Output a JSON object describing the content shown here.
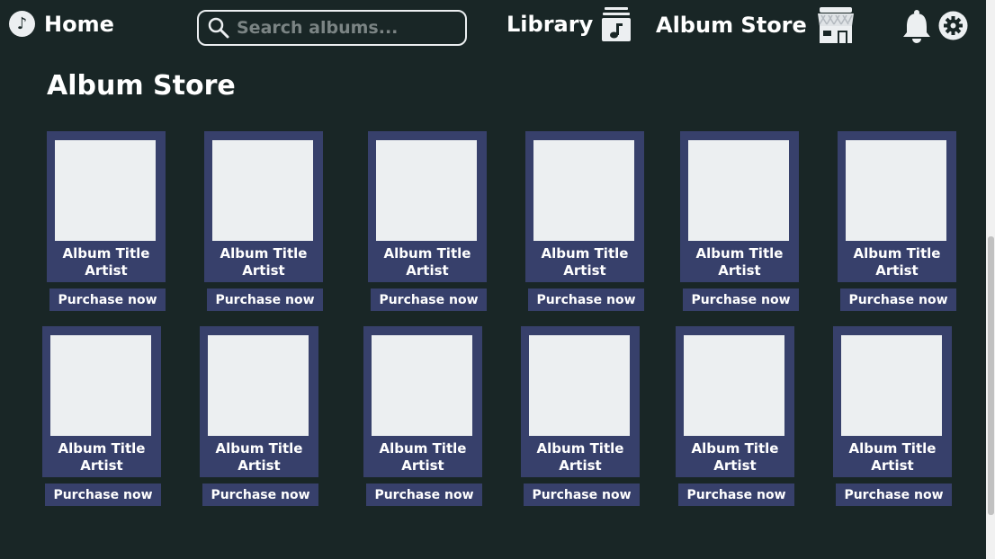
{
  "nav": {
    "home_label": "Home",
    "search_placeholder": "Search albums...",
    "library_label": "Library",
    "store_label": "Album Store",
    "home_icon": "music-note-circle-icon",
    "library_icon": "music-library-icon",
    "store_icon": "storefront-icon",
    "bell_icon": "bell-icon",
    "gear_icon": "gear-icon"
  },
  "main": {
    "title": "Album Store"
  },
  "albums": [
    {
      "title": "Album Title",
      "artist": "Artist",
      "button": "Purchase now"
    },
    {
      "title": "Album Title",
      "artist": "Artist",
      "button": "Purchase now"
    },
    {
      "title": "Album Title",
      "artist": "Artist",
      "button": "Purchase now"
    },
    {
      "title": "Album Title",
      "artist": "Artist",
      "button": "Purchase now"
    },
    {
      "title": "Album Title",
      "artist": "Artist",
      "button": "Purchase now"
    },
    {
      "title": "Album Title",
      "artist": "Artist",
      "button": "Purchase now"
    },
    {
      "title": "Album Title",
      "artist": "Artist",
      "button": "Purchase now"
    },
    {
      "title": "Album Title",
      "artist": "Artist",
      "button": "Purchase now"
    },
    {
      "title": "Album Title",
      "artist": "Artist",
      "button": "Purchase now"
    },
    {
      "title": "Album Title",
      "artist": "Artist",
      "button": "Purchase now"
    },
    {
      "title": "Album Title",
      "artist": "Artist",
      "button": "Purchase now"
    },
    {
      "title": "Album Title",
      "artist": "Artist",
      "button": "Purchase now"
    }
  ],
  "colors": {
    "background": "#192626",
    "card": "#37406b",
    "cover": "#eceff1",
    "text": "#ffffff"
  }
}
